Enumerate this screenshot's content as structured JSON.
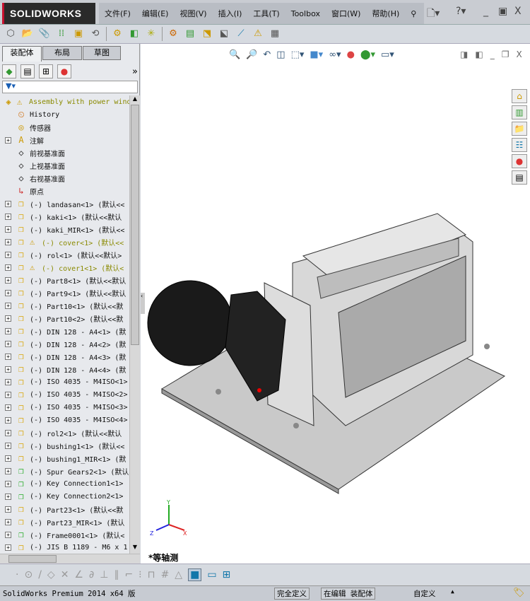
{
  "app": {
    "logo": "SOLIDWORKS"
  },
  "menu": [
    "文件(F)",
    "编辑(E)",
    "视图(V)",
    "插入(I)",
    "工具(T)",
    "Toolbox",
    "窗口(W)",
    "帮助(H)"
  ],
  "panel": {
    "tabs": [
      "装配体",
      "布局",
      "草图"
    ],
    "active_tab": "装配体"
  },
  "tree": [
    {
      "label": "Assembly with power wind",
      "icon": "assembly-icon",
      "warn": true,
      "olive": true,
      "expand": false,
      "level": 0
    },
    {
      "label": "History",
      "icon": "history-icon",
      "level": 1
    },
    {
      "label": "传感器",
      "icon": "sensor-icon",
      "level": 1
    },
    {
      "label": "注解",
      "icon": "annotation-icon",
      "expand": true,
      "level": 1
    },
    {
      "label": "前视基准面",
      "icon": "plane-icon",
      "level": 1
    },
    {
      "label": "上视基准面",
      "icon": "plane-icon",
      "level": 1
    },
    {
      "label": "右视基准面",
      "icon": "plane-icon",
      "level": 1
    },
    {
      "label": "原点",
      "icon": "origin-icon",
      "level": 1
    },
    {
      "label": "(-) landasan<1> (默认<<",
      "icon": "part-icon",
      "expand": true,
      "level": 1
    },
    {
      "label": "(-) kaki<1> (默认<<默认",
      "icon": "part-icon",
      "expand": true,
      "level": 1
    },
    {
      "label": "(-) kaki_MIR<1> (默认<<",
      "icon": "part-icon",
      "expand": true,
      "level": 1
    },
    {
      "label": "(-) cover<1> (默认<<",
      "icon": "part-icon",
      "warn": true,
      "olive": true,
      "expand": true,
      "level": 1
    },
    {
      "label": "(-) rol<1> (默认<<默认>",
      "icon": "part-icon",
      "expand": true,
      "level": 1
    },
    {
      "label": "(-) cover1<1> (默认<",
      "icon": "part-icon",
      "warn": true,
      "olive": true,
      "expand": true,
      "level": 1
    },
    {
      "label": "(-) Part8<1> (默认<<默认",
      "icon": "part-icon",
      "expand": true,
      "level": 1
    },
    {
      "label": "(-) Part9<1> (默认<<默认",
      "icon": "part-icon",
      "expand": true,
      "level": 1
    },
    {
      "label": "(-) Part10<1> (默认<<默",
      "icon": "part-icon",
      "expand": true,
      "level": 1
    },
    {
      "label": "(-) Part10<2> (默认<<默",
      "icon": "part-icon",
      "expand": true,
      "level": 1
    },
    {
      "label": "(-) DIN 128 - A4<1> (默",
      "icon": "part-icon",
      "expand": true,
      "level": 1
    },
    {
      "label": "(-) DIN 128 - A4<2> (默",
      "icon": "part-icon",
      "expand": true,
      "level": 1
    },
    {
      "label": "(-) DIN 128 - A4<3> (默",
      "icon": "part-icon",
      "expand": true,
      "level": 1
    },
    {
      "label": "(-) DIN 128 - A4<4> (默",
      "icon": "part-icon",
      "expand": true,
      "level": 1
    },
    {
      "label": "(-) ISO 4035 - M4ISO<1>",
      "icon": "part-icon",
      "expand": true,
      "level": 1
    },
    {
      "label": "(-) ISO 4035 - M4ISO<2>",
      "icon": "part-icon",
      "expand": true,
      "level": 1
    },
    {
      "label": "(-) ISO 4035 - M4ISO<3>",
      "icon": "part-icon",
      "expand": true,
      "level": 1
    },
    {
      "label": "(-) ISO 4035 - M4ISO<4>",
      "icon": "part-icon",
      "expand": true,
      "level": 1
    },
    {
      "label": "(-) rol2<1> (默认<<默认",
      "icon": "part-icon",
      "expand": true,
      "level": 1
    },
    {
      "label": "(-) bushing1<1> (默认<<",
      "icon": "part-icon",
      "expand": true,
      "level": 1
    },
    {
      "label": "(-) bushing1_MIR<1> (默",
      "icon": "part-icon",
      "expand": true,
      "level": 1
    },
    {
      "label": "(-) Spur Gears2<1> (默认",
      "icon": "subassembly-icon",
      "expand": true,
      "level": 1
    },
    {
      "label": "(-) Key Connection1<1>",
      "icon": "subassembly-icon",
      "expand": true,
      "level": 1
    },
    {
      "label": "(-) Key Connection2<1>",
      "icon": "subassembly-icon",
      "expand": true,
      "level": 1
    },
    {
      "label": "(-) Part23<1> (默认<<默",
      "icon": "part-icon",
      "expand": true,
      "level": 1
    },
    {
      "label": "(-) Part23_MIR<1> (默认",
      "icon": "part-icon",
      "expand": true,
      "level": 1
    },
    {
      "label": "(-) Frame0001<1> (默认<",
      "icon": "subassembly-icon",
      "expand": true,
      "level": 1
    },
    {
      "label": "(-) JIS B 1189 - M6 x 1",
      "icon": "part-icon",
      "expand": true,
      "level": 1
    }
  ],
  "viewport": {
    "view_name": "*等轴测",
    "triad": {
      "x": "X",
      "y": "Y",
      "z": "Z"
    }
  },
  "status": {
    "product": "SolidWorks Premium 2014 x64 版",
    "definition": "完全定义",
    "editing": "在编辑 装配体",
    "units": "自定义",
    "units_arrow": "▲"
  },
  "colors": {
    "logo_bg": "#2a2a2a",
    "logo_accent": "#c8102e",
    "part": "#e8b400",
    "warning": "#f0c000",
    "olive_text": "#8a8a00"
  }
}
